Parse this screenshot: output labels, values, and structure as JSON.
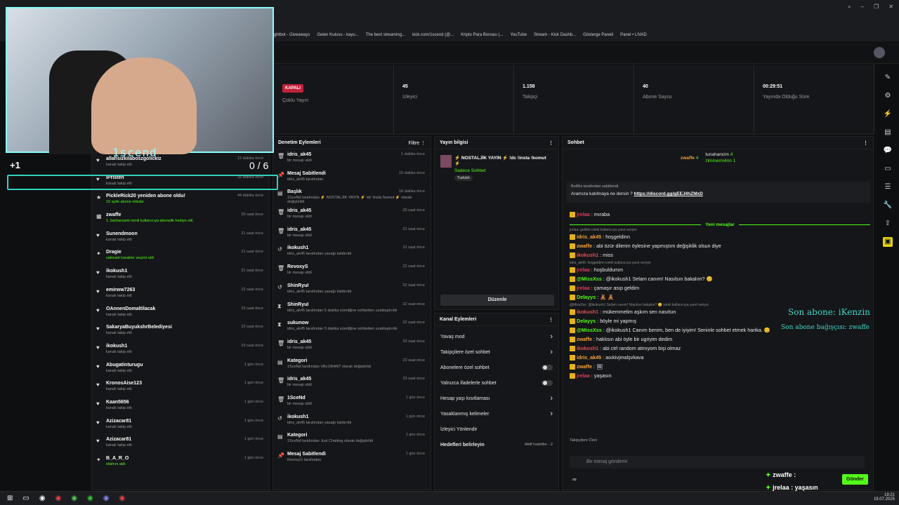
{
  "bookmarks": [
    "ghtbot - Giveaways",
    "Gelen Kutusu - kayu...",
    "The best streaming...",
    "kick.com/1scend (@...",
    "Kripto Para Borsası |...",
    "YouTube",
    "Stream - Kick Dashb...",
    "Gösterge Paneli",
    "Panel • LIVAD"
  ],
  "webcam": {
    "name": "1scend",
    "counter": "+1",
    "score": "0 / 6"
  },
  "stats": [
    {
      "val": "KAPALI",
      "lbl": "Çoklu Yayın"
    },
    {
      "val": "45",
      "lbl": "İzleyici"
    },
    {
      "val": "1.158",
      "lbl": "Takipçi"
    },
    {
      "val": "40",
      "lbl": "Abone Sayısı"
    },
    {
      "val": "00:29:51",
      "lbl": "Yayında Olduğu Süre"
    }
  ],
  "activity": {
    "rows": [
      {
        "name": "allahsizkilaboszgolickiz",
        "sub": "kanalı takip etti",
        "time": "12 dakika önce",
        "icon": "♥"
      },
      {
        "name": "IPristen",
        "sub": "kanalı takip etti",
        "time": "16 dakika önce",
        "icon": "♥"
      },
      {
        "name": "PickleRick20 yeniden abone oldu!",
        "sub": "10 aylık abone oldular",
        "time": "44 dakika önce",
        "icon": "★"
      },
      {
        "name": "zwaffe",
        "sub": "1. barbarsami isimli kullanıcıya abonelik hediye etti.",
        "time": "20 saat önce",
        "icon": "▦"
      },
      {
        "name": "Sunendmoon",
        "sub": "kanalı takip etti",
        "time": "21 saat önce",
        "icon": "♥"
      },
      {
        "name": "Dragie",
        "sub": "valorant karakter seçimi aldı",
        "time": "21 saat önce",
        "icon": "✦"
      },
      {
        "name": "ikokush1",
        "sub": "kanalı takip etti",
        "time": "21 saat önce",
        "icon": "♥"
      },
      {
        "name": "emirww7263",
        "sub": "kanalı takip etti",
        "time": "22 saat önce",
        "icon": "♥"
      },
      {
        "name": "OAnnenDomaltilacak",
        "sub": "kanalı takip etti",
        "time": "23 saat önce",
        "icon": "♥"
      },
      {
        "name": "SakaryaBuyukshrBelediyesi",
        "sub": "kanalı takip etti",
        "time": "23 saat önce",
        "icon": "♥"
      },
      {
        "name": "ikokush1",
        "sub": "kanalı takip etti",
        "time": "23 saat önce",
        "icon": "♥"
      },
      {
        "name": "Abugatinturugu",
        "sub": "kanalı takip etti",
        "time": "1 gün önce",
        "icon": "♥"
      },
      {
        "name": "KronosAise123",
        "sub": "kanalı takip etti",
        "time": "1 gün önce",
        "icon": "♥"
      },
      {
        "name": "Kaan5656",
        "sub": "kanalı takip etti",
        "time": "1 gün önce",
        "icon": "♥"
      },
      {
        "name": "Azizacar81",
        "sub": "kanalı takip etti",
        "time": "1 gün önce",
        "icon": "♥"
      },
      {
        "name": "Azizacar81",
        "sub": "kanalı takip etti",
        "time": "1 gün önce",
        "icon": "♥"
      },
      {
        "name": "B_A_R_O",
        "sub": "silahını aldı",
        "time": "1 gün önce",
        "icon": "✦"
      }
    ]
  },
  "moderation": {
    "title": "Denetim Eylemleri",
    "filter": "Filtre",
    "rows": [
      {
        "name": "idris_ak45",
        "sub": "bir mesajı sildi",
        "time": "1 dakika önce",
        "icon": "🗑"
      },
      {
        "name": "Mesaj Sabitlendi",
        "sub": "idris_ak45 tarafından",
        "time": "16 dakika önce",
        "icon": "📌"
      },
      {
        "name": "Başlık",
        "sub": "1SceNd tarafından ⚡ NOSTALJİK YAYIN ⚡ !dc !insta !komut ⚡ olarak değiştirildi",
        "time": "18 dakika önce",
        "icon": "▤"
      },
      {
        "name": "idris_ak45",
        "sub": "bir mesajı sildi",
        "time": "20 saat önce",
        "icon": "🗑"
      },
      {
        "name": "idris_ak45",
        "sub": "bir mesajı sildi",
        "time": "21 saat önce",
        "icon": "🗑"
      },
      {
        "name": "ikokush1",
        "sub": "idris_ak45 tarafından yasağı kaldırıldı",
        "time": "21 saat önce",
        "icon": "↺"
      },
      {
        "name": "RevoxyS",
        "sub": "bir mesajı sildi",
        "time": "22 saat önce",
        "icon": "🗑"
      },
      {
        "name": "ShinRyuI",
        "sub": "idris_ak45 tarafından yasağı kaldırıldı",
        "time": "22 saat önce",
        "icon": "↺"
      },
      {
        "name": "ShinRyuI",
        "sub": "idris_ak45 tarafından 5 dakika süreliğine sohbetten uzaklaştırıldı",
        "time": "22 saat önce",
        "icon": "⧗"
      },
      {
        "name": "sukunow",
        "sub": "idris_ak45 tarafından 5 dakika süreliğine sohbetten uzaklaştırıldı",
        "time": "22 saat önce",
        "icon": "⧗"
      },
      {
        "name": "idris_ak45",
        "sub": "bir mesajı sildi",
        "time": "23 saat önce",
        "icon": "🗑"
      },
      {
        "name": "Kategori",
        "sub": "1SceNd tarafından VALORANT olarak değiştirildi",
        "time": "23 saat önce",
        "icon": "▤"
      },
      {
        "name": "idris_ak45",
        "sub": "bir mesajı sildi",
        "time": "23 saat önce",
        "icon": "🗑"
      },
      {
        "name": "1SceNd",
        "sub": "bir mesajı sildi",
        "time": "1 gün önce",
        "icon": "🗑"
      },
      {
        "name": "ikokush1",
        "sub": "idris_ak45 tarafından yasağı kaldırıldı",
        "time": "1 gün önce",
        "icon": "↺"
      },
      {
        "name": "Kategori",
        "sub": "1SceNd tarafından Just Chatting olarak değiştirildi",
        "time": "1 gün önce",
        "icon": "▤"
      },
      {
        "name": "Mesaj Sabitlendi",
        "sub": "RevoxyS tarafından",
        "time": "1 gün önce",
        "icon": "📌"
      }
    ]
  },
  "streaminfo": {
    "title": "Yayın bilgisi",
    "stream_title": "⚡ NOSTALJİK YAYIN ⚡ !dc !insta !komut ⚡",
    "mode": "Sadece Sohbet",
    "lang": "Turkish",
    "edit": "Düzenle"
  },
  "channel_actions": {
    "title": "Kanal Eylemleri",
    "items": [
      {
        "label": "Yavaş mod",
        "ctl": "arrow"
      },
      {
        "label": "Takipçilere özel sohbet",
        "ctl": "arrow"
      },
      {
        "label": "Abonelere özel sohbet",
        "ctl": "toggle"
      },
      {
        "label": "Yalnızca ifadelerle sohbet",
        "ctl": "toggle"
      },
      {
        "label": "Hesap yaşı kısıtlaması",
        "ctl": "arrow"
      },
      {
        "label": "Yasaklanmış kelimeler",
        "ctl": "arrow"
      },
      {
        "label": "İzleyici Yönlendir",
        "ctl": "none"
      },
      {
        "label": "Hedefleri belirleyin",
        "ctl": "goal"
      }
    ],
    "goal_text": "Aktif hedefler - 2"
  },
  "chat": {
    "title": "Sohbet",
    "top_gifters": [
      {
        "name": "zwaffe",
        "count": "4"
      },
      {
        "name": "tunahancim",
        "count": "4"
      },
      {
        "name": "zimmerm4nn",
        "count": "1"
      }
    ],
    "pinned_by": "BotRix tarafından sabitlendi",
    "pinned_msg": "Aramıza katılmaya ne dersin ?",
    "pinned_link": "https://discord.gg/gEEJ4hZMxD",
    "new_messages": "Yeni mesajlar",
    "messages": [
      {
        "user": "jrelaa",
        "color": "#e23b5a",
        "text": "mıraba",
        "reply": ""
      },
      {
        "user": "idris_ak45",
        "color": "#f5a33c",
        "text": "hoşgeldinn",
        "reply": "jrelaa: geldim isimli kullanıcıya yanıt veriyor"
      },
      {
        "user": "zwaffe",
        "color": "#f5a33c",
        "text": "abi özür dilerim öylesine yapmıştım değişiklik olsun diye",
        "reply": ""
      },
      {
        "user": "ikokush1",
        "color": "#e04e4e",
        "text": "miss",
        "reply": ""
      },
      {
        "user": "jrelaa",
        "color": "#e23b5a",
        "text": "hoşbuldumm",
        "reply": "idris_ak45: hoşgeldinn isimli kullanıcıya yanıt veriyor"
      },
      {
        "user": "@MissXss",
        "color": "#53fc18",
        "text": "@ikokush1 Selam canım! Nasılsın bakalım? 😊",
        "reply": ""
      },
      {
        "user": "jrelaa",
        "color": "#e23b5a",
        "text": "çamaşır asıp geldim",
        "reply": ""
      },
      {
        "user": "Delayys",
        "color": "#53fc18",
        "text": "🧸 🧸",
        "reply": ""
      },
      {
        "user": "ikokush1",
        "color": "#e04e4e",
        "text": "mükemmelim aşkım sen nasılsın",
        "reply": "@MissXss: @ikokush1 Selam canım! Nasılsın bakalım? 😊 isimli kullanıcıya yanıt veriyor"
      },
      {
        "user": "Delayys",
        "color": "#53fc18",
        "text": "böyle mi yapmış",
        "reply": ""
      },
      {
        "user": "@MissXss",
        "color": "#53fc18",
        "text": "@ikokush1 Canım benim, ben de iyiyim! Seninle sohbet etmek harika. 😊",
        "reply": ""
      },
      {
        "user": "zwaffe",
        "color": "#f5a33c",
        "text": "haklısın abi öyle bir ugriyim dedim",
        "reply": ""
      },
      {
        "user": "ikokush1",
        "color": "#e04e4e",
        "text": "abi ctrl random atmıyom bişi olmaz",
        "reply": ""
      },
      {
        "user": "idris_ak45",
        "color": "#f5a33c",
        "text": "aoıkivjmalşvkava",
        "reply": ""
      },
      {
        "user": "zwaffe",
        "color": "#f5a33c",
        "text": "🖼",
        "reply": ""
      },
      {
        "user": "jrelaa",
        "color": "#e23b5a",
        "text": "yaşasın",
        "reply": ""
      }
    ],
    "emote_label": "Takipçilere Özel",
    "input_placeholder": "Bir mesaj gönderin",
    "send": "Gönder",
    "points": "∞"
  },
  "overlay": {
    "last_sub": "Son abone: iKenzin",
    "last_gift": "Son abone bağışçısı: zwaffe",
    "chat1_user": "zwaffe",
    "chat2_user": "jrelaa",
    "chat2_text": "yaşasın"
  },
  "taskbar": {
    "time": "19:21",
    "date": "19.07.2025"
  }
}
